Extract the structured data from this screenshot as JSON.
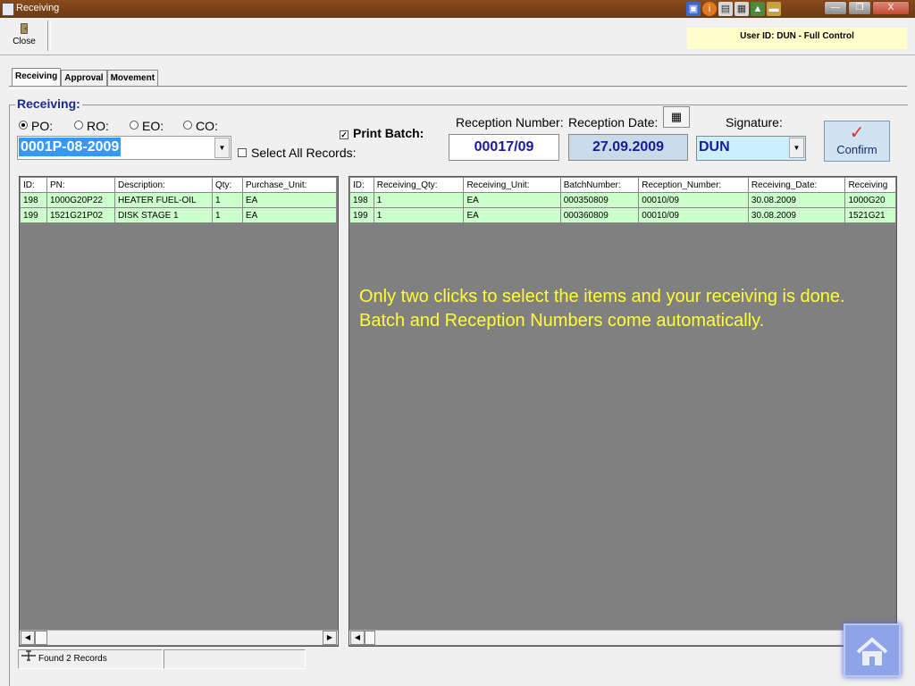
{
  "window": {
    "title": "Receiving",
    "controls": {
      "minimize": "—",
      "restore": "❐",
      "close": "X"
    }
  },
  "toolbar": {
    "close_label": "Close",
    "user_info": "User ID: DUN - Full Control"
  },
  "tabs": [
    {
      "label": "Receiving",
      "active": true
    },
    {
      "label": "Approval",
      "active": false
    },
    {
      "label": "Movement",
      "active": false
    }
  ],
  "form": {
    "group_title": "Receiving:",
    "order_types": [
      {
        "label": "PO:",
        "selected": true
      },
      {
        "label": "RO:",
        "selected": false
      },
      {
        "label": "EO:",
        "selected": false
      },
      {
        "label": "CO:",
        "selected": false
      }
    ],
    "order_number": "0001P-08-2009",
    "select_all_label": "Select All Records:",
    "select_all_checked": false,
    "print_batch_label": "Print Batch:",
    "print_batch_checked": true,
    "reception_number_label": "Reception Number:",
    "reception_number": "00017/09",
    "reception_date_label": "Reception Date:",
    "reception_date": "27.09.2009",
    "signature_label": "Signature:",
    "signature": "DUN",
    "confirm_label": "Confirm"
  },
  "left_grid": {
    "columns": [
      "ID:",
      "PN:",
      "Description:",
      "Qty:",
      "Purchase_Unit:"
    ],
    "rows": [
      [
        "198",
        "1000G20P22",
        "HEATER FUEL-OIL",
        "1",
        "EA"
      ],
      [
        "199",
        "1521G21P02",
        "DISK STAGE 1",
        "1",
        "EA"
      ]
    ]
  },
  "right_grid": {
    "columns": [
      "ID:",
      "Receiving_Qty:",
      "Receiving_Unit:",
      "BatchNumber:",
      "Reception_Number:",
      "Receiving_Date:",
      "Receiving"
    ],
    "rows": [
      [
        "198",
        "1",
        "EA",
        "000350809",
        "00010/09",
        "30.08.2009",
        "1000G20"
      ],
      [
        "199",
        "1",
        "EA",
        "000360809",
        "00010/09",
        "30.08.2009",
        "1521G21"
      ]
    ]
  },
  "overlay_text": "Only two clicks to select the items and your receiving is done. Batch and Reception Numbers come automatically.",
  "status": {
    "records_text": "Found 2 Records"
  },
  "colors": {
    "title_bar": "#7a4216",
    "grid_row": "#ccffcc",
    "grid_bg": "#808080",
    "user_info_bg": "#ffffcc",
    "overlay_text": "#ffff33",
    "field_text": "#1a1a9c"
  }
}
